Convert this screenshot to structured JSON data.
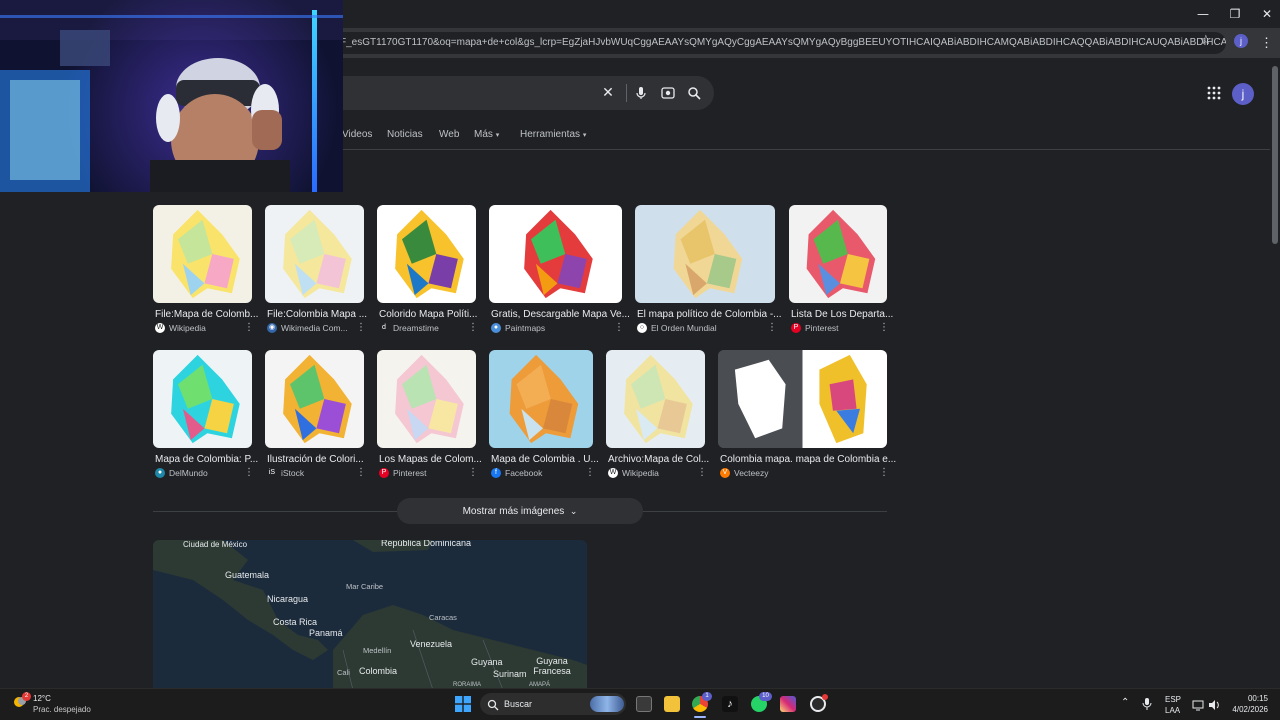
{
  "window": {
    "minimize": "—",
    "restore": "❐",
    "close": "✕"
  },
  "browser": {
    "url": "F_esGT1170GT1170&oq=mapa+de+col&gs_lcrp=EgZjaHJvbWUqCggAEAAYsQMYgAQyCggAEAAYsQMYgAQyBggBEEUYOTIHCAIQABiABDIHCAMQABiABDIHCAQQABiABDIHCAUQABiABDIHCAYQABiABDIHCAcQABiABDIHCA",
    "profile_initial": "j",
    "menu_icon": "⋮"
  },
  "search": {
    "clear_icon": "✕",
    "mic_icon": "🎤",
    "lens_icon": "⌾",
    "search_icon": "⌕",
    "account_initial": "j",
    "tabs": [
      "Videos",
      "Noticias",
      "Web",
      "Más",
      "Herramientas"
    ]
  },
  "images": [
    {
      "title": "File:Mapa de Colomb...",
      "source": "Wikipedia",
      "fav": "W",
      "fav_color": "#ffffff"
    },
    {
      "title": "File:Colombia Mapa ...",
      "source": "Wikimedia Com...",
      "fav": "◉",
      "fav_color": "#3366aa"
    },
    {
      "title": "Colorido Mapa Políti...",
      "source": "Dreamstime",
      "fav": "d",
      "fav_color": "#202124"
    },
    {
      "title": "Gratis, Descargable Mapa Ve...",
      "source": "Paintmaps",
      "fav": "●",
      "fav_color": "#4a90d9"
    },
    {
      "title": "El mapa político de Colombia -...",
      "source": "El Orden Mundial",
      "fav": "○",
      "fav_color": "#ffffff"
    },
    {
      "title": "Lista De Los Departa...",
      "source": "Pinterest",
      "fav": "P",
      "fav_color": "#e60023"
    },
    {
      "title": "Mapa de Colombia: P...",
      "source": "DelMundo",
      "fav": "●",
      "fav_color": "#1e88a8"
    },
    {
      "title": "Ilustración de Colori...",
      "source": "iStock",
      "fav": "iS",
      "fav_color": "#202124"
    },
    {
      "title": "Los Mapas de Colom...",
      "source": "Pinterest",
      "fav": "P",
      "fav_color": "#e60023"
    },
    {
      "title": "Mapa de Colombia . U...",
      "source": "Facebook",
      "fav": "f",
      "fav_color": "#1877f2"
    },
    {
      "title": "Archivo:Mapa de Col...",
      "source": "Wikipedia",
      "fav": "W",
      "fav_color": "#ffffff"
    },
    {
      "title": "Colombia mapa. mapa de Colombia e...",
      "source": "Vecteezy",
      "fav": "V",
      "fav_color": "#ff7a00"
    }
  ],
  "more_images": {
    "label": "Mostrar más imágenes",
    "chevron": "⌄"
  },
  "map": {
    "labels": [
      "Ciudad de México",
      "República Dominicana",
      "Guatemala",
      "Mar Caribe",
      "Nicaragua",
      "Caracas",
      "Costa Rica",
      "Panamá",
      "Venezuela",
      "Medellín",
      "Guyana",
      "Guyana Francesa",
      "Cali",
      "Colombia",
      "Surinam",
      "RORAIMA",
      "AMAPÁ"
    ]
  },
  "taskbar": {
    "weather_temp": "12°C",
    "weather_desc": "Prac. despejado",
    "weather_badge": "2",
    "search_label": "Buscar",
    "lang_top": "ESP",
    "lang_bottom": "LAA",
    "time": "00:15",
    "date": "4/02/2026",
    "whatsapp_badge": "10",
    "chrome_badge": "1"
  }
}
